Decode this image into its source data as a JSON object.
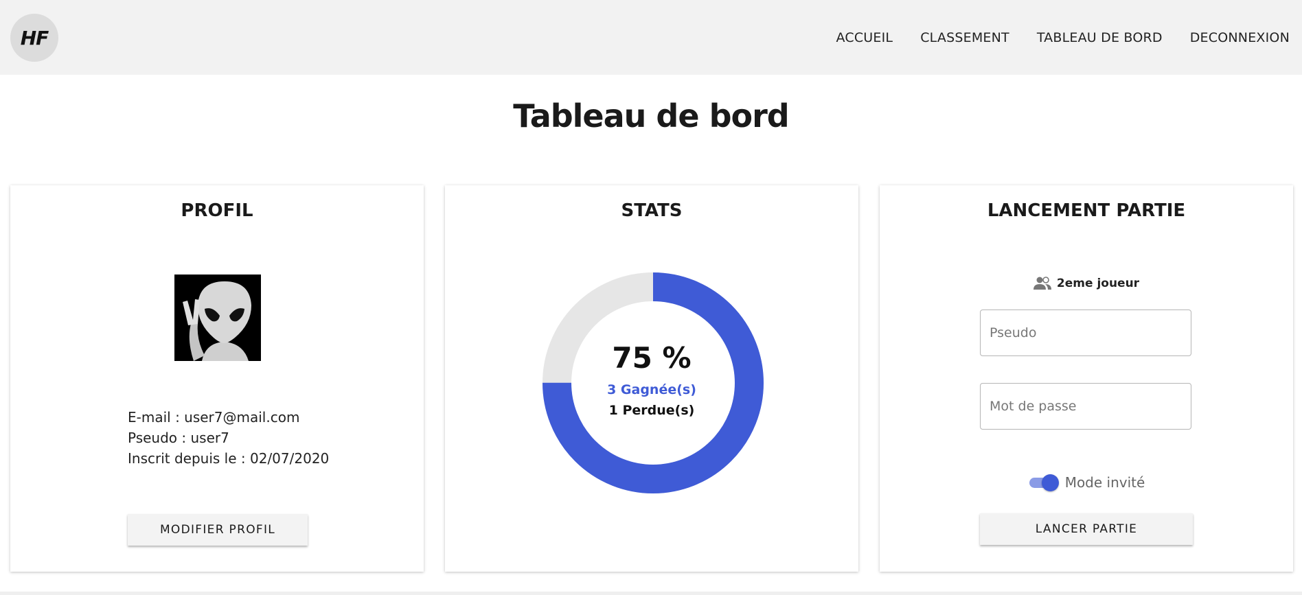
{
  "header": {
    "logo_text": "HF",
    "nav": [
      "ACCUEIL",
      "CLASSEMENT",
      "TABLEAU DE BORD",
      "DECONNEXION"
    ]
  },
  "page_title": "Tableau de bord",
  "profil": {
    "title": "PROFIL",
    "avatar_icon": "alien-peace-icon",
    "email": "E-mail : user7@mail.com",
    "pseudo": "Pseudo : user7",
    "inscrit": "Inscrit depuis le : 02/07/2020",
    "button": "MODIFIER PROFIL"
  },
  "stats": {
    "title": "STATS",
    "percent": "75 %",
    "won_label": "3 Gagnée(s)",
    "lost_label": "1 Perdue(s)",
    "won": 3,
    "lost": 1,
    "colors": {
      "won": "#3f5bd6",
      "lost": "#e6e6e6"
    }
  },
  "lancement": {
    "title": "LANCEMENT PARTIE",
    "player_label": "2eme joueur",
    "player_icon": "people-icon",
    "pseudo_placeholder": "Pseudo",
    "password_placeholder": "Mot de passe",
    "guest_mode_label": "Mode invité",
    "guest_mode_on": true,
    "button": "LANCER PARTIE"
  }
}
